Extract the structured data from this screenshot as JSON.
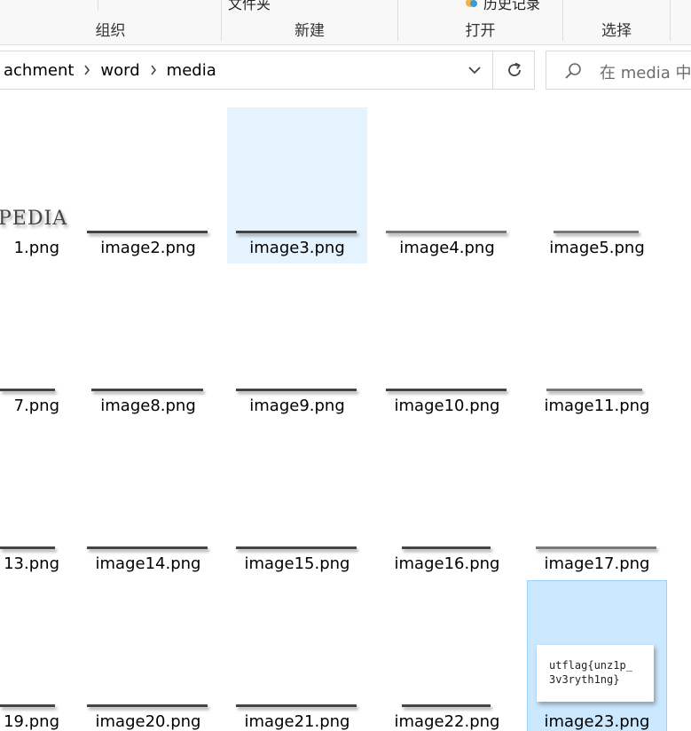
{
  "ribbon": {
    "top_items": [
      "文件夹",
      "历史记录"
    ],
    "groups": [
      "组织",
      "新建",
      "打开",
      "选择"
    ]
  },
  "address": {
    "crumbs": [
      "achment",
      "word",
      "media"
    ]
  },
  "search": {
    "placeholder": "在 media 中搜"
  },
  "files": [
    {
      "name": "1.png",
      "thumb": "logo",
      "logo_text": "PEDIA"
    },
    {
      "name": "image2.png",
      "thumb": "line"
    },
    {
      "name": "image3.png",
      "thumb": "line",
      "selected": "hover"
    },
    {
      "name": "image4.png",
      "thumb": "line"
    },
    {
      "name": "image5.png",
      "thumb": "line"
    },
    {
      "name": "7.png",
      "thumb": "line"
    },
    {
      "name": "image8.png",
      "thumb": "line"
    },
    {
      "name": "image9.png",
      "thumb": "line"
    },
    {
      "name": "image10.png",
      "thumb": "line"
    },
    {
      "name": "image11.png",
      "thumb": "line"
    },
    {
      "name": "13.png",
      "thumb": "line"
    },
    {
      "name": "image14.png",
      "thumb": "line"
    },
    {
      "name": "image15.png",
      "thumb": "line"
    },
    {
      "name": "image16.png",
      "thumb": "line"
    },
    {
      "name": "image17.png",
      "thumb": "line"
    },
    {
      "name": "19.png",
      "thumb": "line"
    },
    {
      "name": "image20.png",
      "thumb": "line"
    },
    {
      "name": "image21.png",
      "thumb": "line"
    },
    {
      "name": "image22.png",
      "thumb": "line"
    },
    {
      "name": "image23.png",
      "thumb": "card",
      "selected": "selected",
      "card_text": "utflag{unz1p_\n3v3ryth1ng}"
    }
  ]
}
